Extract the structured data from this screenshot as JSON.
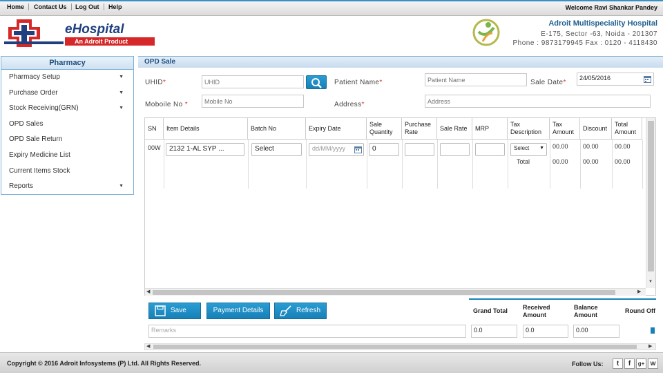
{
  "topnav": {
    "links": [
      "Home",
      "Contact Us",
      "Log Out",
      "Help"
    ],
    "welcome": "Welcome Ravi Shankar Pandey"
  },
  "header": {
    "logo_text": "eHospital",
    "logo_tagline": "An Adroit Product",
    "hospital_name": "Adroit Multispeciality Hospital",
    "address_line1": "E-175, Sector -63, Noida - 201307",
    "address_line2": "Phone : 9873179945 Fax : 0120 - 4118430"
  },
  "sidebar": {
    "title": "Pharmacy",
    "items": [
      {
        "label": "Pharmacy Setup",
        "has_caret": true
      },
      {
        "label": "Purchase Order",
        "has_caret": true
      },
      {
        "label": "Stock Receiving(GRN)",
        "has_caret": true
      },
      {
        "label": "OPD Sales",
        "has_caret": false
      },
      {
        "label": "OPD Sale Return",
        "has_caret": false
      },
      {
        "label": "Expiry Medicine List",
        "has_caret": false
      },
      {
        "label": "Current Items Stock",
        "has_caret": false
      },
      {
        "label": "Reports",
        "has_caret": true
      }
    ]
  },
  "main": {
    "title": "OPD Sale",
    "form": {
      "uhid_label": "UHID",
      "uhid_placeholder": "UHID",
      "patient_name_label": "Patient Name",
      "patient_name_placeholder": "Patient Name",
      "sale_date_label": "Sale Date",
      "sale_date_value": "24/05/2016",
      "mobile_label": "Moboile No",
      "mobile_placeholder": "Mobile No",
      "address_label": "Address",
      "address_placeholder": "Address",
      "required_mark": "*"
    },
    "table": {
      "headers": [
        "SN",
        "Item Details",
        "Batch No",
        "Expiry Date",
        "Sale Quantity",
        "Purchase Rate",
        "Sale Rate",
        "MRP",
        "Tax Description",
        "Tax Amount",
        "Discount",
        "Total Amount"
      ],
      "row": {
        "sn": "00W",
        "item": "2132 1-AL SYP ...",
        "batch": "Select",
        "expiry_placeholder": "dd/MM/yyyy",
        "sale_qty": "0",
        "tax_desc": "Select",
        "tax_amount": "00.00",
        "discount": "00.00",
        "total": "00.00"
      },
      "total_row": {
        "label": "Total",
        "tax_amount": "00.00",
        "discount": "00.00",
        "total": "00.00"
      }
    },
    "buttons": {
      "save": "Save",
      "payment": "Payment Details",
      "refresh": "Refresh"
    },
    "summary": {
      "grand_total_label": "Grand Total",
      "received_label": "Received Amount",
      "balance_label": "Balance Amount",
      "round_off_label": "Round Off",
      "grand_total": "0.0",
      "received": "0.0",
      "balance": "0.00"
    },
    "remarks_placeholder": "Remarks"
  },
  "footer": {
    "copyright": "Copyright © 2016 Adroit Infosystems (P) Ltd. All Rights Reserved.",
    "follow": "Follow Us:",
    "social": [
      "t",
      "f",
      "g+",
      "w"
    ]
  },
  "colors": {
    "accent": "#1780b7",
    "header_blue": "#1f5f8f",
    "logo_red": "#d62828"
  }
}
